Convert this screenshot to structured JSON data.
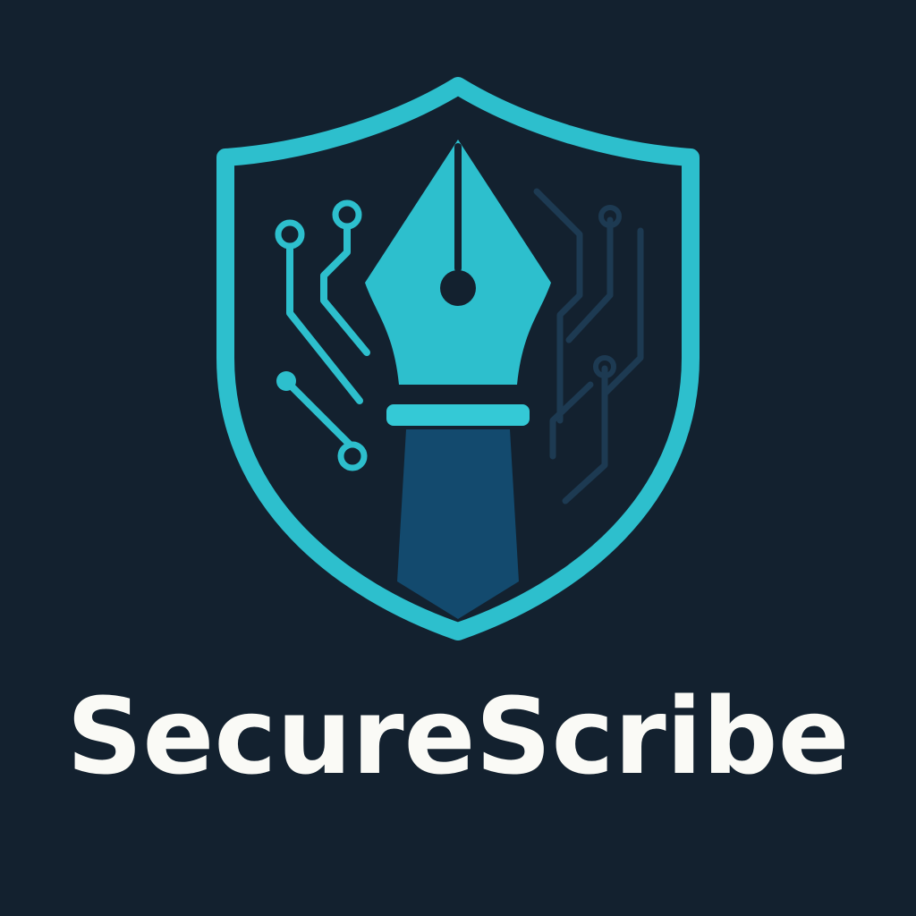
{
  "logo": {
    "wordmark": "SecureScribe",
    "emblem_icon": "shield-pen-circuit-icon"
  },
  "colors": {
    "background": "#13212F",
    "accent": "#2DBFCD",
    "accent_light": "#34C9D6",
    "pen_body": "#134A6E",
    "circuit_dim": "#1D3A52",
    "text": "#FAFAF6"
  }
}
